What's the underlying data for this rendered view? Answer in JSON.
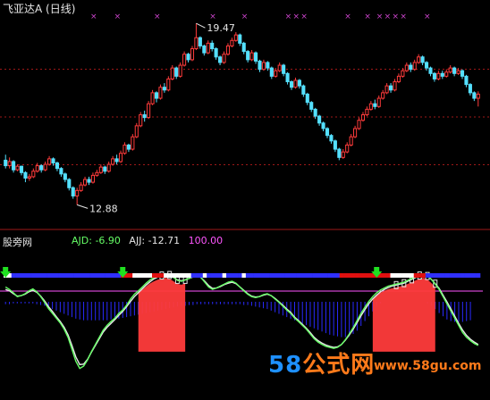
{
  "header": {
    "title": "飞亚达A (日线)"
  },
  "indicator": {
    "name": "股旁网",
    "ajd_label": "AJD: ",
    "ajd_value": "-6.90",
    "ajj_label": "AJJ: ",
    "ajj_value": "-12.71",
    "extra_value": "100.00"
  },
  "watermark": {
    "text_num": "58",
    "text_cn": "公式网",
    "url": "www.58gu.com"
  },
  "colors": {
    "up": "#ff3b3b",
    "down": "#54e0ff",
    "grid": "#a01818",
    "ajd": "#66ff66",
    "ajj": "#e6e6e6",
    "extra": "#ff55ff",
    "signal_bar": "#3030ff",
    "hist": "#2a2aff",
    "marker": "#cc44cc"
  },
  "chart_data": [
    {
      "type": "candlestick",
      "title": "飞亚达A (日线)",
      "annotations": [
        {
          "label": "19.47",
          "type": "high"
        },
        {
          "label": "12.88",
          "type": "low"
        }
      ],
      "candles": [
        [
          14.5,
          14.3,
          14.7,
          14.2
        ],
        [
          14.3,
          14.45,
          14.6,
          14.2
        ],
        [
          14.45,
          14.15,
          14.5,
          14.05
        ],
        [
          14.15,
          14.28,
          14.35,
          14.1
        ],
        [
          14.28,
          14.05,
          14.3,
          13.95
        ],
        [
          14.05,
          13.85,
          14.1,
          13.7
        ],
        [
          13.85,
          13.9,
          14.0,
          13.75
        ],
        [
          13.9,
          14.1,
          14.2,
          13.85
        ],
        [
          14.1,
          14.3,
          14.4,
          14.05
        ],
        [
          14.3,
          14.15,
          14.35,
          14.05
        ],
        [
          14.15,
          14.35,
          14.45,
          14.1
        ],
        [
          14.35,
          14.55,
          14.65,
          14.3
        ],
        [
          14.55,
          14.4,
          14.6,
          14.3
        ],
        [
          14.4,
          14.2,
          14.45,
          14.1
        ],
        [
          14.2,
          14.0,
          14.25,
          13.9
        ],
        [
          14.0,
          13.8,
          14.05,
          13.7
        ],
        [
          13.8,
          13.5,
          13.85,
          13.4
        ],
        [
          13.5,
          13.2,
          13.55,
          13.1
        ],
        [
          13.2,
          13.4,
          13.5,
          12.88
        ],
        [
          13.4,
          13.6,
          13.7,
          13.35
        ],
        [
          13.6,
          13.8,
          13.9,
          13.55
        ],
        [
          13.8,
          13.7,
          13.9,
          13.6
        ],
        [
          13.7,
          13.95,
          14.05,
          13.65
        ],
        [
          13.95,
          14.05,
          14.15,
          13.9
        ],
        [
          14.05,
          14.25,
          14.35,
          14.0
        ],
        [
          14.25,
          14.1,
          14.3,
          14.0
        ],
        [
          14.1,
          14.35,
          14.45,
          14.05
        ],
        [
          14.35,
          14.55,
          14.65,
          14.3
        ],
        [
          14.55,
          14.45,
          14.7,
          14.35
        ],
        [
          14.45,
          14.75,
          14.85,
          14.4
        ],
        [
          14.75,
          15.05,
          15.15,
          14.7
        ],
        [
          15.05,
          14.9,
          15.1,
          14.8
        ],
        [
          14.9,
          15.35,
          15.45,
          14.85
        ],
        [
          15.35,
          15.75,
          15.85,
          15.3
        ],
        [
          15.75,
          16.15,
          16.25,
          15.7
        ],
        [
          16.15,
          16.05,
          16.3,
          15.9
        ],
        [
          16.05,
          16.55,
          16.65,
          16.0
        ],
        [
          16.55,
          16.95,
          17.05,
          16.5
        ],
        [
          16.95,
          16.75,
          17.0,
          16.6
        ],
        [
          16.75,
          17.15,
          17.25,
          16.7
        ],
        [
          17.15,
          17.05,
          17.3,
          16.95
        ],
        [
          17.05,
          17.45,
          17.55,
          17.0
        ],
        [
          17.45,
          17.85,
          17.95,
          17.4
        ],
        [
          17.85,
          17.55,
          17.9,
          17.45
        ],
        [
          17.55,
          17.95,
          18.05,
          17.5
        ],
        [
          17.95,
          18.35,
          18.45,
          17.9
        ],
        [
          18.35,
          18.15,
          18.4,
          18.05
        ],
        [
          18.15,
          18.55,
          18.65,
          18.1
        ],
        [
          18.55,
          18.95,
          19.47,
          18.5
        ],
        [
          18.95,
          18.65,
          19.0,
          18.55
        ],
        [
          18.65,
          18.4,
          18.7,
          18.3
        ],
        [
          18.4,
          18.75,
          18.85,
          18.35
        ],
        [
          18.75,
          18.55,
          18.85,
          18.45
        ],
        [
          18.55,
          18.25,
          18.6,
          18.15
        ],
        [
          18.25,
          18.05,
          18.3,
          17.95
        ],
        [
          18.05,
          18.35,
          18.45,
          18.0
        ],
        [
          18.35,
          18.65,
          18.75,
          18.3
        ],
        [
          18.65,
          18.85,
          18.95,
          18.6
        ],
        [
          18.85,
          19.05,
          19.15,
          18.8
        ],
        [
          19.05,
          18.75,
          19.1,
          18.65
        ],
        [
          18.75,
          18.45,
          18.8,
          18.35
        ],
        [
          18.45,
          18.15,
          18.5,
          18.05
        ],
        [
          18.15,
          18.4,
          18.5,
          18.1
        ],
        [
          18.4,
          18.1,
          18.45,
          18.0
        ],
        [
          18.1,
          17.8,
          18.15,
          17.7
        ],
        [
          17.8,
          18.05,
          18.15,
          17.75
        ],
        [
          18.05,
          17.85,
          18.1,
          17.75
        ],
        [
          17.85,
          17.55,
          17.9,
          17.45
        ],
        [
          17.55,
          17.75,
          17.85,
          17.5
        ],
        [
          17.75,
          17.95,
          18.05,
          17.7
        ],
        [
          17.95,
          17.65,
          18.0,
          17.55
        ],
        [
          17.65,
          17.35,
          17.7,
          17.25
        ],
        [
          17.35,
          17.15,
          17.4,
          17.05
        ],
        [
          17.15,
          17.4,
          17.5,
          17.1
        ],
        [
          17.4,
          17.2,
          17.45,
          17.1
        ],
        [
          17.2,
          16.9,
          17.25,
          16.8
        ],
        [
          16.9,
          16.6,
          16.95,
          16.5
        ],
        [
          16.6,
          16.35,
          16.65,
          16.25
        ],
        [
          16.35,
          16.1,
          16.4,
          16.0
        ],
        [
          16.1,
          15.85,
          16.15,
          15.75
        ],
        [
          15.85,
          15.65,
          15.9,
          15.55
        ],
        [
          15.65,
          15.4,
          15.7,
          15.3
        ],
        [
          15.4,
          15.2,
          15.45,
          15.1
        ],
        [
          15.2,
          14.9,
          15.25,
          14.8
        ],
        [
          14.9,
          14.6,
          14.95,
          14.5
        ],
        [
          14.6,
          14.8,
          14.9,
          14.55
        ],
        [
          14.8,
          15.05,
          15.15,
          14.75
        ],
        [
          15.05,
          15.35,
          15.45,
          15.0
        ],
        [
          15.35,
          15.65,
          15.75,
          15.3
        ],
        [
          15.65,
          15.95,
          16.05,
          15.6
        ],
        [
          15.95,
          16.15,
          16.25,
          15.9
        ],
        [
          16.15,
          16.35,
          16.45,
          16.1
        ],
        [
          16.35,
          16.55,
          16.65,
          16.3
        ],
        [
          16.55,
          16.45,
          16.7,
          16.35
        ],
        [
          16.45,
          16.75,
          16.85,
          16.4
        ],
        [
          16.75,
          16.95,
          17.05,
          16.7
        ],
        [
          16.95,
          17.2,
          17.3,
          16.9
        ],
        [
          17.2,
          17.05,
          17.3,
          16.95
        ],
        [
          17.05,
          17.35,
          17.45,
          17.0
        ],
        [
          17.35,
          17.55,
          17.65,
          17.3
        ],
        [
          17.55,
          17.75,
          17.85,
          17.5
        ],
        [
          17.75,
          17.95,
          18.05,
          17.7
        ],
        [
          17.95,
          17.8,
          18.05,
          17.7
        ],
        [
          17.8,
          18.05,
          18.15,
          17.75
        ],
        [
          18.05,
          18.25,
          18.35,
          18.0
        ],
        [
          18.25,
          18.05,
          18.3,
          17.95
        ],
        [
          18.05,
          17.85,
          18.1,
          17.75
        ],
        [
          17.85,
          17.65,
          17.9,
          17.55
        ],
        [
          17.65,
          17.45,
          17.7,
          17.35
        ],
        [
          17.45,
          17.65,
          17.75,
          17.4
        ],
        [
          17.65,
          17.55,
          17.75,
          17.45
        ],
        [
          17.55,
          17.7,
          17.8,
          17.5
        ],
        [
          17.7,
          17.85,
          17.95,
          17.65
        ],
        [
          17.85,
          17.65,
          17.9,
          17.55
        ],
        [
          17.65,
          17.75,
          17.85,
          17.6
        ],
        [
          17.75,
          17.55,
          17.8,
          17.45
        ],
        [
          17.55,
          17.25,
          17.6,
          17.15
        ],
        [
          17.25,
          16.95,
          17.3,
          16.85
        ],
        [
          16.95,
          16.75,
          17.0,
          16.65
        ],
        [
          16.75,
          16.9,
          17.0,
          16.45
        ]
      ]
    },
    {
      "type": "indicator",
      "title": "股旁网",
      "series": [
        {
          "name": "AJD",
          "last": -6.9
        },
        {
          "name": "AJJ",
          "last": -12.71
        }
      ],
      "level": 100.0,
      "ajd": [
        60,
        55,
        48,
        40,
        42,
        46,
        52,
        56,
        50,
        40,
        28,
        15,
        5,
        -5,
        -15,
        -28,
        -45,
        -70,
        -95,
        -110,
        -105,
        -92,
        -75,
        -60,
        -45,
        -30,
        -20,
        -12,
        -5,
        5,
        12,
        22,
        35,
        45,
        52,
        60,
        68,
        75,
        80,
        84,
        86,
        88,
        86,
        80,
        74,
        72,
        75,
        78,
        82,
        86,
        80,
        70,
        60,
        55,
        58,
        62,
        66,
        70,
        72,
        68,
        60,
        52,
        45,
        40,
        38,
        40,
        44,
        46,
        42,
        35,
        28,
        20,
        12,
        5,
        -5,
        -12,
        -20,
        -28,
        -38,
        -48,
        -55,
        -60,
        -64,
        -66,
        -68,
        -66,
        -60,
        -50,
        -38,
        -25,
        -10,
        5,
        18,
        30,
        40,
        48,
        54,
        58,
        62,
        64,
        66,
        68,
        70,
        74,
        78,
        82,
        86,
        88,
        84,
        76,
        66,
        55,
        40,
        25,
        10,
        -5,
        -20,
        -35,
        -45,
        -52,
        -58,
        -62
      ],
      "ajj": [
        55,
        52,
        46,
        41,
        42,
        45,
        50,
        53,
        49,
        41,
        31,
        19,
        9,
        -2,
        -12,
        -24,
        -40,
        -62,
        -86,
        -102,
        -101,
        -91,
        -76,
        -62,
        -48,
        -34,
        -24,
        -16,
        -8,
        1,
        9,
        19,
        30,
        40,
        48,
        56,
        64,
        71,
        77,
        81,
        84,
        86,
        85,
        80,
        75,
        73,
        75,
        78,
        81,
        84,
        80,
        72,
        63,
        57,
        58,
        61,
        65,
        68,
        70,
        67,
        60,
        53,
        46,
        41,
        39,
        40,
        43,
        45,
        42,
        36,
        29,
        22,
        14,
        7,
        -3,
        -10,
        -18,
        -26,
        -35,
        -45,
        -52,
        -57,
        -61,
        -64,
        -66,
        -65,
        -60,
        -51,
        -40,
        -28,
        -14,
        0,
        13,
        25,
        35,
        43,
        50,
        55,
        59,
        62,
        64,
        66,
        68,
        72,
        76,
        80,
        84,
        86,
        83,
        76,
        67,
        57,
        43,
        29,
        14,
        -1,
        -16,
        -30,
        -41,
        -49,
        -55,
        -60
      ],
      "hist": [
        -3,
        -3,
        -2,
        -2,
        -2,
        -2,
        -2,
        -2,
        -3,
        -4,
        -5,
        -7,
        -9,
        -11,
        -13,
        -15,
        -17,
        -19,
        -21,
        -22,
        -23,
        -23,
        -23,
        -23,
        -23,
        -23,
        -23,
        -22,
        -22,
        -21,
        -20,
        -19,
        -18,
        -17,
        -16,
        -15,
        -14,
        -13,
        -12,
        -11,
        -10,
        -9,
        -8,
        -7,
        -6,
        -5,
        -5,
        -4,
        -4,
        -3,
        -3,
        -3,
        -3,
        -3,
        -3,
        -3,
        -3,
        -3,
        -3,
        -3,
        -3,
        -4,
        -4,
        -5,
        -6,
        -7,
        -8,
        -9,
        -11,
        -13,
        -15,
        -17,
        -19,
        -21,
        -23,
        -25,
        -27,
        -29,
        -31,
        -33,
        -35,
        -37,
        -39,
        -41,
        -42,
        -43,
        -44,
        -44,
        -43,
        -40,
        -36,
        -30,
        -24,
        -18,
        -12,
        -6,
        -2,
        0,
        0,
        0,
        0,
        0,
        0,
        0,
        0,
        0,
        0,
        0,
        -2,
        -5,
        -9,
        -14,
        -18,
        -22,
        -24,
        -25,
        -25,
        -25,
        -24,
        -23
      ],
      "red_fill_ranges": [
        [
          34,
          46
        ],
        [
          94,
          110
        ]
      ],
      "signal_strip": [
        "w",
        "w",
        "b",
        "b",
        "b",
        "b",
        "b",
        "b",
        "b",
        "b",
        "b",
        "b",
        "b",
        "b",
        "b",
        "b",
        "b",
        "b",
        "b",
        "b",
        "b",
        "b",
        "b",
        "b",
        "b",
        "b",
        "b",
        "b",
        "b",
        "b",
        "r",
        "r",
        "r",
        "w",
        "w",
        "w",
        "w",
        "w",
        "r",
        "r",
        "r",
        "w",
        "w",
        "w",
        "w",
        "w",
        "w",
        "w",
        "b",
        "b",
        "b",
        "w",
        "b",
        "b",
        "b",
        "b",
        "w",
        "b",
        "b",
        "b",
        "b",
        "w",
        "b",
        "b",
        "b",
        "b",
        "b",
        "b",
        "b",
        "b",
        "b",
        "b",
        "b",
        "b",
        "b",
        "b",
        "b",
        "b",
        "b",
        "b",
        "b",
        "b",
        "b",
        "b",
        "b",
        "b",
        "r",
        "r",
        "r",
        "r",
        "r",
        "r",
        "r",
        "r",
        "r",
        "r",
        "r",
        "r",
        "r",
        "w",
        "w",
        "w",
        "w",
        "w",
        "w",
        "r",
        "r",
        "r",
        "b",
        "b",
        "b",
        "b",
        "b",
        "b",
        "b",
        "b",
        "b",
        "b",
        "b",
        "b",
        "b",
        "b"
      ],
      "arrows": [
        0,
        30,
        95
      ]
    }
  ]
}
